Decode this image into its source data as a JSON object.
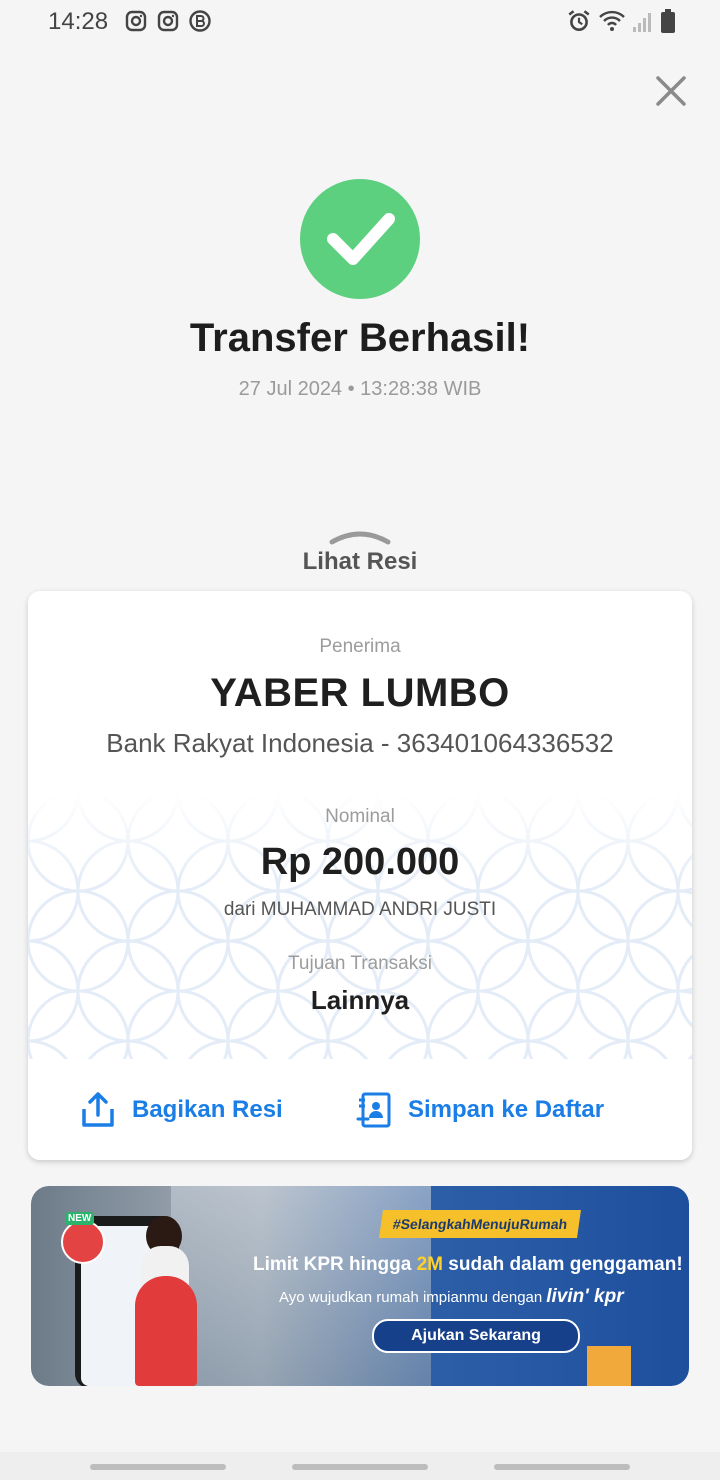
{
  "status_bar": {
    "time": "14:28",
    "left_icons": [
      "instagram-icon",
      "instagram-icon",
      "b-messenger-icon"
    ],
    "right_icons": [
      "alarm-icon",
      "wifi-icon",
      "signal-icon",
      "battery-icon"
    ]
  },
  "header": {
    "close_icon": "close-icon"
  },
  "result": {
    "icon": "check-icon",
    "title": "Transfer Berhasil!",
    "timestamp": "27 Jul 2024 • 13:28:38 WIB"
  },
  "receipt": {
    "toggle_label": "Lihat Resi",
    "recipient_label": "Penerima",
    "recipient_name": "YABER LUMBO",
    "bank_info": "Bank Rakyat Indonesia - 363401064336532",
    "amount_label": "Nominal",
    "amount": "Rp 200.000",
    "sender": "dari MUHAMMAD ANDRI JUSTI",
    "purpose_label": "Tujuan Transaksi",
    "purpose": "Lainnya",
    "actions": {
      "share_label": "Bagikan Resi",
      "save_label": "Simpan ke Daftar"
    }
  },
  "banner": {
    "badge_new": "NEW",
    "hashtag": "#SelangkahMenujuRumah",
    "headline_pre": "Limit KPR hingga ",
    "headline_highlight": "2M",
    "headline_post": " sudah dalam genggaman!",
    "subline": "Ayo wujudkan rumah impianmu dengan",
    "brand": "livin' kpr",
    "cta_label": "Ajukan Sekarang"
  },
  "colors": {
    "accent": "#1a7ee6",
    "success": "#5cd07f",
    "background": "#f5f5f5"
  }
}
